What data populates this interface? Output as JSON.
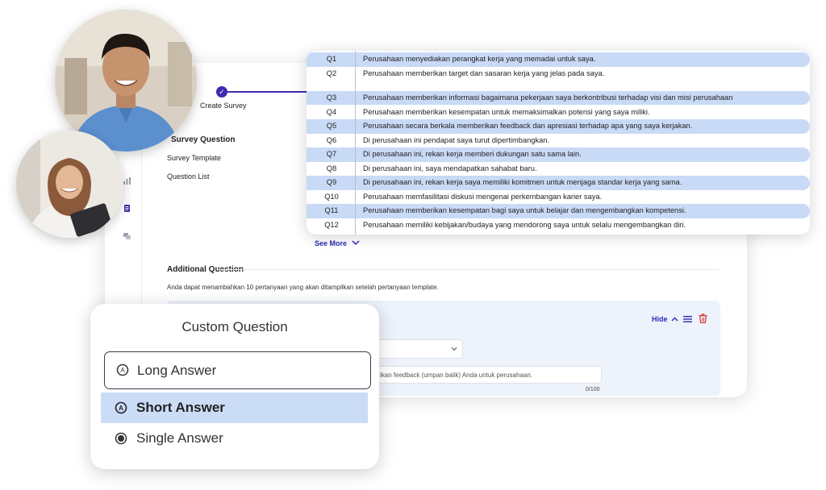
{
  "stepper": {
    "step_label": "Create Survey",
    "check": "✓"
  },
  "survey": {
    "section_title": "Survey Question",
    "template_label": "Survey Template",
    "question_list_label": "Question List",
    "see_more": "See More"
  },
  "additional": {
    "section_title": "Additional Question",
    "hint": "Anda dapat menambahkan 10 pertanyaan yang akan ditampilkan setelah pertanyaan template.",
    "hide_label": "Hide",
    "input_text": "ikan feedback (umpan balik) Anda untuk perusahaan.",
    "counter": "0/100"
  },
  "questions": [
    {
      "id": "Q1",
      "text": "Perusahaan menyediakan perangkat kerja yang memadai untuk saya."
    },
    {
      "id": "Q2",
      "text": "Perusahaan memberikan target dan sasaran kerja yang jelas pada saya."
    },
    {
      "id": "Q3",
      "text": "Perusahaan memberikan informasi bagaimana pekerjaan saya berkontribusi terhadap visi dan misi perusahaan"
    },
    {
      "id": "Q4",
      "text": "Perusahaan memberikan kesempatan untuk memaksimalkan potensi yang saya miliki."
    },
    {
      "id": "Q5",
      "text": "Perusahaan secara berkala memberikan feedback dan apresiasi terhadap apa yang saya kerjakan."
    },
    {
      "id": "Q6",
      "text": "Di perusahaan ini pendapat saya turut dipertimbangkan."
    },
    {
      "id": "Q7",
      "text": "Di perusahaan ini, rekan kerja memberi dukungan satu sama lain."
    },
    {
      "id": "Q8",
      "text": "Di perusahaan ini, saya mendapatkan sahabat baru."
    },
    {
      "id": "Q9",
      "text": "Di perusahaan ini, rekan kerja saya memiliki komitmen untuk menjaga standar kerja yang sama."
    },
    {
      "id": "Q10",
      "text": "Perusahaan memfasilitasi diskusi mengenai perkembangan karier saya."
    },
    {
      "id": "Q11",
      "text": "Perusahaan memberikan kesempatan bagi saya untuk belajar dan mengembangkan kompetensi."
    },
    {
      "id": "Q12",
      "text": "Perusahaan memiliki kebijakan/budaya yang mendorong saya untuk selalu mengembangkan diri."
    }
  ],
  "custom_question": {
    "title": "Custom Question",
    "options": [
      {
        "label": "Long Answer",
        "state": "outlined",
        "icon": "answer-a-icon"
      },
      {
        "label": "Short Answer",
        "state": "selected",
        "icon": "answer-a-icon"
      },
      {
        "label": "Single Answer",
        "state": "default",
        "icon": "radio-icon"
      }
    ]
  },
  "colors": {
    "accent": "#3d2bb0",
    "link": "#2a2ab8",
    "row_highlight": "#c9daf6",
    "delete": "#d93a3a"
  }
}
